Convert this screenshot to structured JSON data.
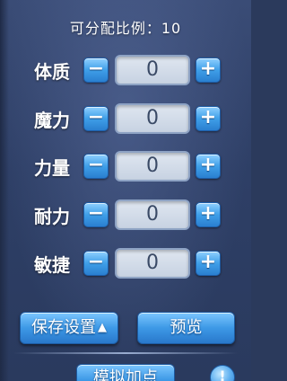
{
  "header": {
    "title": "可分配比例：10"
  },
  "stats": [
    {
      "label": "体质",
      "value": "0"
    },
    {
      "label": "魔力",
      "value": "0"
    },
    {
      "label": "力量",
      "value": "0"
    },
    {
      "label": "耐力",
      "value": "0"
    },
    {
      "label": "敏捷",
      "value": "0"
    }
  ],
  "controls": {
    "minus_symbol": "−",
    "plus_symbol": "+"
  },
  "buttons": {
    "save_label": "保存设置",
    "save_caret": "▲",
    "preview_label": "预览",
    "simulate_label": "模拟加点",
    "info_label": "!"
  },
  "colors": {
    "panel_bg": "#2e3f66",
    "button_blue": "#3d99e6",
    "value_box_bg": "#d3dcea"
  },
  "icons": {
    "minus": "minus-icon",
    "plus": "plus-icon",
    "caret": "caret-up-icon",
    "info": "info-icon"
  }
}
